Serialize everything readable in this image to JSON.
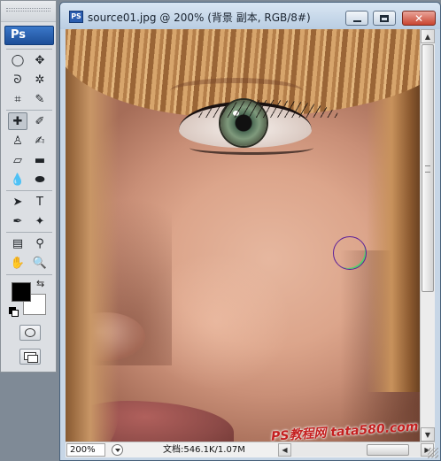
{
  "toolbox": {
    "logo_text": "Ps",
    "tools": [
      {
        "name": "marquee-tool-icon",
        "glyph": "◯"
      },
      {
        "name": "move-tool-icon",
        "glyph": "✥"
      },
      {
        "name": "lasso-tool-icon",
        "glyph": "ᘐ"
      },
      {
        "name": "magic-wand-tool-icon",
        "glyph": "✲"
      },
      {
        "name": "crop-tool-icon",
        "glyph": "⌗"
      },
      {
        "name": "slice-tool-icon",
        "glyph": "✎"
      },
      {
        "name": "healing-brush-tool-icon",
        "glyph": "✚"
      },
      {
        "name": "brush-tool-icon",
        "glyph": "✐"
      },
      {
        "name": "clone-stamp-tool-icon",
        "glyph": "♙"
      },
      {
        "name": "history-brush-tool-icon",
        "glyph": "✍"
      },
      {
        "name": "eraser-tool-icon",
        "glyph": "▱"
      },
      {
        "name": "gradient-tool-icon",
        "glyph": "▬"
      },
      {
        "name": "blur-tool-icon",
        "glyph": "💧"
      },
      {
        "name": "dodge-tool-icon",
        "glyph": "⬬"
      },
      {
        "name": "path-selection-tool-icon",
        "glyph": "➤"
      },
      {
        "name": "type-tool-icon",
        "glyph": "T"
      },
      {
        "name": "pen-tool-icon",
        "glyph": "✒"
      },
      {
        "name": "custom-shape-tool-icon",
        "glyph": "✦"
      },
      {
        "name": "notes-tool-icon",
        "glyph": "▤"
      },
      {
        "name": "eyedropper-tool-icon",
        "glyph": "⚲"
      },
      {
        "name": "hand-tool-icon",
        "glyph": "✋"
      },
      {
        "name": "zoom-tool-icon",
        "glyph": "🔍"
      }
    ],
    "foreground_color": "#000000",
    "background_color": "#ffffff"
  },
  "document": {
    "title": "source01.jpg @ 200% (背景 副本, RGB/8#)",
    "icon_label": "PS",
    "window_buttons": {
      "minimize": "",
      "maximize": "",
      "close": "✕"
    }
  },
  "statusbar": {
    "zoom": "200%",
    "doc_info": "文档:546.1K/1.07M"
  },
  "watermark": "PS教程网 tata580.com",
  "colors": {
    "titlebar": "#c7d6e6",
    "close_button": "#c9442f",
    "brush_cursor": "#5b1f9a"
  }
}
